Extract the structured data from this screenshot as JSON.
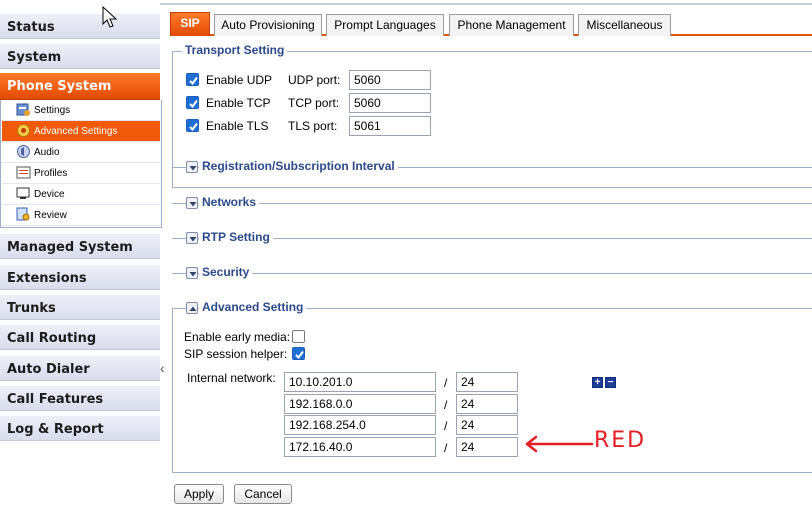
{
  "sidebar": {
    "items": [
      {
        "label": "Status"
      },
      {
        "label": "System"
      },
      {
        "label": "Phone System"
      },
      {
        "label": "Managed System"
      },
      {
        "label": "Extensions"
      },
      {
        "label": "Trunks"
      },
      {
        "label": "Call Routing"
      },
      {
        "label": "Auto Dialer"
      },
      {
        "label": "Call Features"
      },
      {
        "label": "Log & Report"
      }
    ],
    "sub_items": [
      {
        "label": "Settings",
        "icon": "settings-icon"
      },
      {
        "label": "Advanced Settings",
        "icon": "gear-icon"
      },
      {
        "label": "Audio",
        "icon": "audio-icon"
      },
      {
        "label": "Profiles",
        "icon": "profiles-icon"
      },
      {
        "label": "Device",
        "icon": "device-icon"
      },
      {
        "label": "Review",
        "icon": "review-icon"
      }
    ],
    "collapse_glyph": "‹"
  },
  "tabs": [
    {
      "label": "SIP"
    },
    {
      "label": "Auto Provisioning"
    },
    {
      "label": "Prompt Languages"
    },
    {
      "label": "Phone Management"
    },
    {
      "label": "Miscellaneous"
    }
  ],
  "transport": {
    "title": "Transport Setting",
    "rows": [
      {
        "enable_label": "Enable UDP",
        "port_label": "UDP port:",
        "port": "5060",
        "checked": true
      },
      {
        "enable_label": "Enable TCP",
        "port_label": "TCP port:",
        "port": "5060",
        "checked": true
      },
      {
        "enable_label": "Enable TLS",
        "port_label": "TLS port:",
        "port": "5061",
        "checked": true
      }
    ]
  },
  "collapsed_sections": [
    {
      "title": "Registration/Subscription Interval"
    },
    {
      "title": "Networks"
    },
    {
      "title": "RTP Setting"
    },
    {
      "title": "Security"
    }
  ],
  "advanced": {
    "title": "Advanced Setting",
    "early_media_label": "Enable early media:",
    "early_media_checked": false,
    "session_helper_label": "SIP session helper:",
    "session_helper_checked": true,
    "internal_network_label": "Internal network:",
    "slash": "/",
    "networks": [
      {
        "ip": "10.10.201.0",
        "mask": "24"
      },
      {
        "ip": "192.168.0.0",
        "mask": "24"
      },
      {
        "ip": "192.168.254.0",
        "mask": "24"
      },
      {
        "ip": "172.16.40.0",
        "mask": "24"
      }
    ],
    "add_glyph": "+",
    "remove_glyph": "−"
  },
  "buttons": {
    "apply": "Apply",
    "cancel": "Cancel"
  },
  "annotation": {
    "text": "RED",
    "color": "#e21e24"
  },
  "colors": {
    "accent": "#e24a05",
    "section_title": "#2a4a8c",
    "checkbox": "#1f6fd6"
  }
}
